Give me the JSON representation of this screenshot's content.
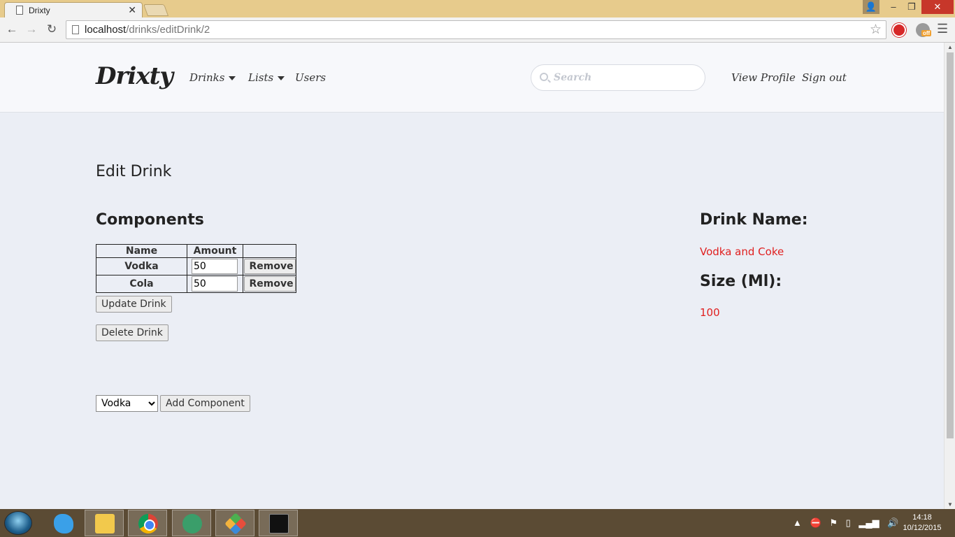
{
  "browser": {
    "tab_title": "Drixty",
    "url_host": "localhost",
    "url_path": "/drinks/editDrink/2"
  },
  "header": {
    "logo": "Drixty",
    "nav": {
      "drinks": "Drinks",
      "lists": "Lists",
      "users": "Users",
      "view_profile": "View Profile",
      "sign_out": "Sign out"
    },
    "search_placeholder": "Search"
  },
  "page": {
    "title": "Edit Drink",
    "components_heading": "Components",
    "table": {
      "headers": [
        "Name",
        "Amount",
        ""
      ],
      "rows": [
        {
          "name": "Vodka",
          "amount": "50",
          "action": "Remove"
        },
        {
          "name": "Cola",
          "amount": "50",
          "action": "Remove"
        }
      ]
    },
    "update_button": "Update Drink",
    "delete_button": "Delete Drink",
    "component_select": {
      "selected": "Vodka"
    },
    "add_button": "Add Component",
    "drink_name_label": "Drink Name:",
    "drink_name_value": "Vodka and Coke",
    "size_label": "Size (Ml):",
    "size_value": "100"
  },
  "taskbar": {
    "time": "14:18",
    "date": "10/12/2015"
  },
  "colors": {
    "accent_red": "#e02020",
    "page_bg": "#ebeef5",
    "header_bg": "#f7f8fb",
    "titlebar": "#e7cb8c",
    "taskbar": "#5b4b34"
  }
}
